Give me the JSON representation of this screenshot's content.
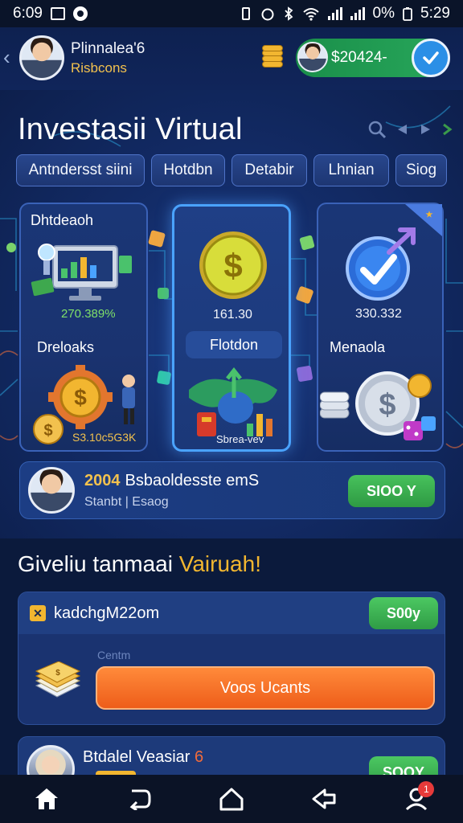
{
  "status_bar": {
    "time_left": "6:09",
    "battery": "0%",
    "time_right": "5:29"
  },
  "header": {
    "user_name": "Plinnalea'6",
    "user_sub": "Risbcons",
    "balance": "$20424-"
  },
  "hero": {
    "title": "Investasii Virtual",
    "chips": [
      "Antndersst siini",
      "Hotdbn",
      "Detabir",
      "Lhnian",
      "Siog"
    ],
    "cards": [
      {
        "label_top": "Dhtdeaoh",
        "value_top": "270.389%",
        "label_bottom": "Dreloaks",
        "value_bottom": "S3.10c5G3K"
      },
      {
        "value_top": "161.30",
        "label_mid": "Flotdon",
        "value_bottom": "Sbrea-vev"
      },
      {
        "value_top": "330.332",
        "label_bottom": "Menaola"
      }
    ]
  },
  "promo": {
    "year": "2004",
    "title": "Bsbaoldesste emS",
    "subtitle": "Stanbt | Esaog",
    "button": "SIOO Y"
  },
  "section": {
    "title_main": "Giveliu tanmaai ",
    "title_highlight": "Vairuah!"
  },
  "offer1": {
    "title": "kadchgM22om",
    "button": "S00y",
    "label": "Centm",
    "cta": "Voos Ucants"
  },
  "offer2": {
    "title": "Btdalel Veasiar",
    "title_mark": "6",
    "button": "SOOY"
  },
  "nav": {
    "profile_badge": "1"
  },
  "colors": {
    "accent_gold": "#f2b630",
    "accent_green": "#2e9a43",
    "accent_orange": "#ee5d1a",
    "accent_blue": "#2b8fe6"
  }
}
